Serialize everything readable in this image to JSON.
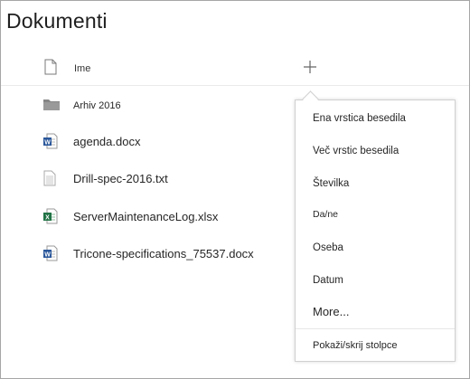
{
  "page": {
    "title": "Dokumenti"
  },
  "header": {
    "column_name": "Ime",
    "add_column_icon": "plus-icon",
    "type_icon": "document-icon"
  },
  "files": [
    {
      "name": "Arhiv 2016",
      "icon": "folder-icon",
      "color": "#858585"
    },
    {
      "name": "agenda.docx",
      "icon": "word-icon",
      "color": "#2b579a"
    },
    {
      "name": "Drill-spec-2016.txt",
      "icon": "text-file-icon",
      "color": "#c8c8c8"
    },
    {
      "name": "ServerMaintenanceLog.xlsx",
      "icon": "excel-icon",
      "color": "#217346"
    },
    {
      "name": "Tricone-specifications_75537.docx",
      "icon": "word-icon",
      "color": "#2b579a"
    }
  ],
  "add_column_menu": {
    "items": [
      "Ena vrstica besedila",
      "Več vrstic besedila",
      "Številka",
      "Da/ne",
      "Oseba",
      "Datum",
      "More..."
    ],
    "footer_item": "Pokaži/skrij stolpce"
  }
}
